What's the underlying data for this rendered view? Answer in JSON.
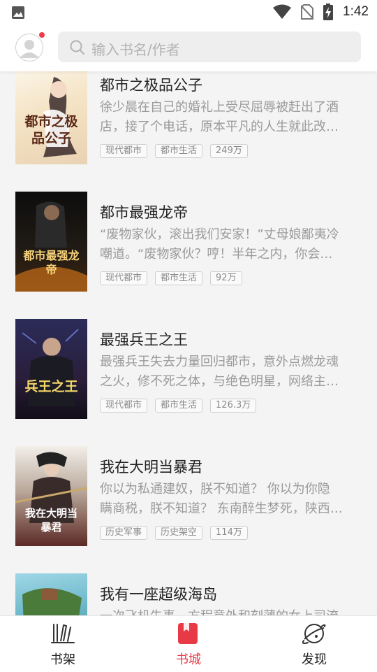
{
  "status_bar": {
    "time": "1:42"
  },
  "header": {
    "search_placeholder": "输入书名/作者"
  },
  "books": [
    {
      "title": "都市之极品公子",
      "desc_line1": "徐少晨在自己的婚礼上受尽屈辱被赶出了酒",
      "desc_line2": "店，接了个电话，原本平凡的人生就此改…",
      "tags": [
        "现代都市",
        "都市生活",
        "249万"
      ],
      "cover_text": "都市之极品公子"
    },
    {
      "title": "都市最强龙帝",
      "desc_line1": "“废物家伙，滚出我们安家！”丈母娘鄙夷冷",
      "desc_line2": "嘲道。“废物家伙？哼！半年之内，你会…",
      "tags": [
        "现代都市",
        "都市生活",
        "92万"
      ],
      "cover_text": "都市最强龙帝"
    },
    {
      "title": "最强兵王之王",
      "desc_line1": "最强兵王失去力量回归都市，意外点燃龙魂",
      "desc_line2": "之火，修不死之体，与绝色明星，网络主…",
      "tags": [
        "现代都市",
        "都市生活",
        "126.3万"
      ],
      "cover_text": "兵王之王"
    },
    {
      "title": "我在大明当暴君",
      "desc_line1": "你以为私通建奴，朕不知道？ 你以为你隐",
      "desc_line2": "瞒商税，朕不知道？ 东南醉生梦死，陕西…",
      "tags": [
        "历史军事",
        "历史架空",
        "114万"
      ],
      "cover_text": "我在大明当暴君"
    },
    {
      "title": "我有一座超级海岛",
      "desc_line1": "一次飞机失事，方程意外和刻薄的女上司流",
      "desc_line2": "",
      "tags": [],
      "cover_text": ""
    }
  ],
  "nav": {
    "bookshelf": "书架",
    "bookstore": "书城",
    "discover": "发现"
  },
  "colors": {
    "accent": "#e83a46",
    "background": "#f4f4f4"
  }
}
